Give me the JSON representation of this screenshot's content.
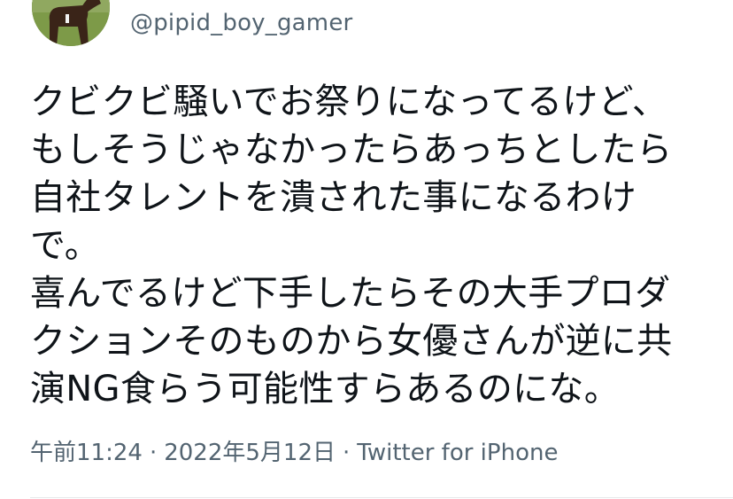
{
  "tweet": {
    "handle": "@pipid_boy_gamer",
    "text_lines": [
      "クビクビ騒いでお祭りになってるけど、",
      "もしそうじゃなかったらあっちとしたら",
      "自社タレントを潰された事になるわけ",
      "で。",
      "喜んでるけど下手したらその大手プロダ",
      "クションそのものから女優さんが逆に共",
      "演NG食らう可能性すらあるのにな。"
    ],
    "time": "午前11:24",
    "date": "2022年5月12日",
    "separator": "·",
    "source": "Twitter for iPhone"
  },
  "colors": {
    "text": "#0f1419",
    "secondary": "#536471",
    "divider": "#e6e8ea"
  },
  "icons": {
    "avatar": "horse-avatar"
  }
}
